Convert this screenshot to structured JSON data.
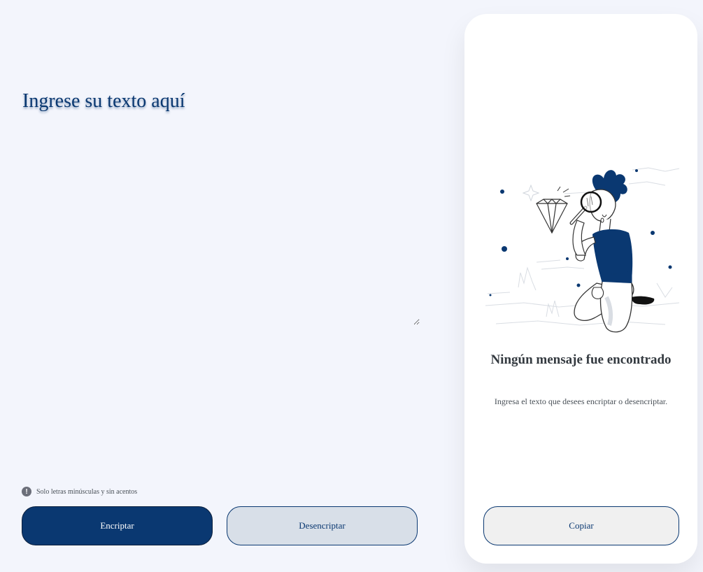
{
  "input": {
    "placeholder": "Ingrese su texto aquí",
    "value": ""
  },
  "hint": {
    "icon": "info-circle-icon",
    "text": "Solo letras minúsculas y sin acentos"
  },
  "buttons": {
    "encrypt_label": "Encriptar",
    "decrypt_label": "Desencriptar"
  },
  "output_panel": {
    "illustration": "person-with-magnifying-glass-and-diamond",
    "title": "Ningún mensaje fue encontrado",
    "description": "Ingresa el texto que desees encriptar o desencriptar.",
    "copy_label": "Copiar"
  },
  "colors": {
    "background": "#f3f5fc",
    "primary": "#0a3871",
    "secondary_button": "#d8dfe8",
    "panel": "#ffffff",
    "copy_button": "#f0f0f0"
  }
}
